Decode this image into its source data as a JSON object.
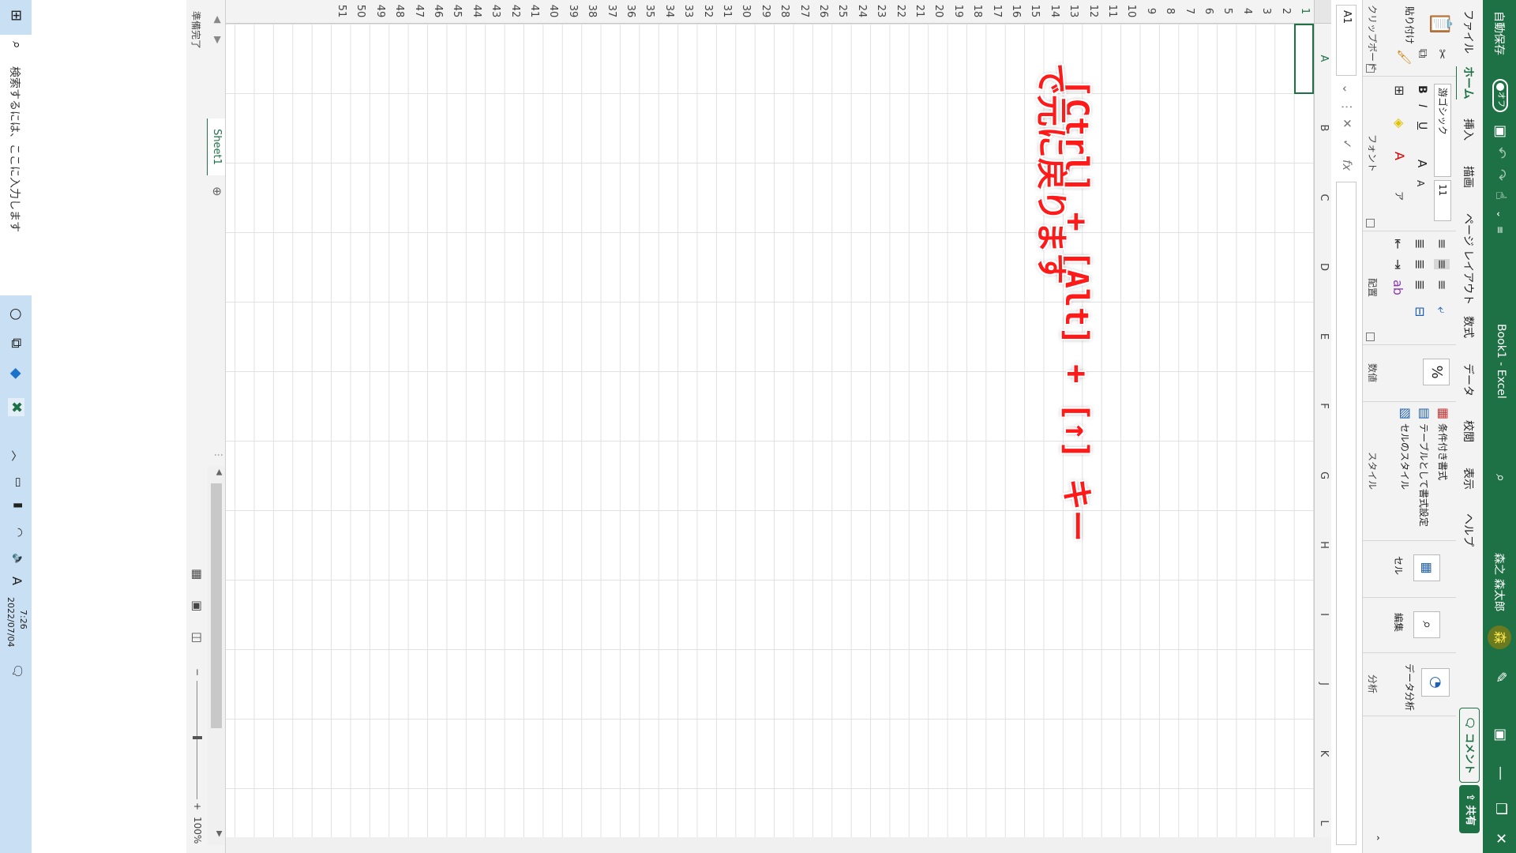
{
  "title_bar": {
    "autosave_label": "自動保存",
    "autosave_state": "オフ",
    "doc_title": "Book1 - Excel",
    "user_name": "森之 森太郎",
    "avatar_initial": "森"
  },
  "tabs": [
    "ファイル",
    "ホーム",
    "挿入",
    "描画",
    "ページ レイアウト",
    "数式",
    "データ",
    "校閲",
    "表示",
    "ヘルプ"
  ],
  "active_tab": "ホーム",
  "comments_label": "コメント",
  "share_label": "共有",
  "ribbon": {
    "clipboard": {
      "paste_label": "貼り付け",
      "group_label": "クリップボード"
    },
    "font": {
      "font_name": "游ゴシック",
      "font_size": "11",
      "bold": "B",
      "italic": "I",
      "underline": "U",
      "grow": "A",
      "shrink": "A",
      "group_label": "フォント"
    },
    "alignment": {
      "group_label": "配置"
    },
    "number": {
      "percent": "%",
      "group_label": "数値"
    },
    "styles": {
      "conditional": "条件付き書式",
      "as_table": "テーブルとして書式設定",
      "cell_styles": "セルのスタイル",
      "group_label": "スタイル"
    },
    "cells": {
      "label": "セル"
    },
    "editing": {
      "label": "編集"
    },
    "analysis": {
      "data_analysis": "データ分析",
      "group_label": "分析"
    }
  },
  "formula_bar": {
    "name_box": "A1",
    "fx": "fx",
    "value": ""
  },
  "columns": [
    "A",
    "B",
    "C",
    "D",
    "E",
    "F",
    "G",
    "H",
    "I",
    "J",
    "K",
    "L"
  ],
  "rows": [
    "1",
    "2",
    "3",
    "4",
    "5",
    "6",
    "7",
    "8",
    "9",
    "10",
    "11",
    "12",
    "13",
    "14",
    "15",
    "16",
    "17",
    "18",
    "19",
    "20",
    "21",
    "22",
    "23",
    "24",
    "25",
    "26",
    "27",
    "28",
    "29",
    "30",
    "31",
    "32",
    "33",
    "34",
    "35",
    "36",
    "37",
    "38",
    "39",
    "40",
    "41",
    "42",
    "43",
    "44",
    "45",
    "46",
    "47",
    "48",
    "49",
    "50",
    "51"
  ],
  "selected_cell": "A1",
  "annotation": {
    "line1": "[Ctrl] + [Alt] + [↑] キー",
    "line2": "で元に戻ります"
  },
  "sheet_tab": "Sheet1",
  "status": {
    "ready": "準備完了",
    "zoom": "100%"
  },
  "taskbar": {
    "search_placeholder": "検索するには、ここに入力します",
    "time": "7:26",
    "date": "2022/07/04"
  }
}
